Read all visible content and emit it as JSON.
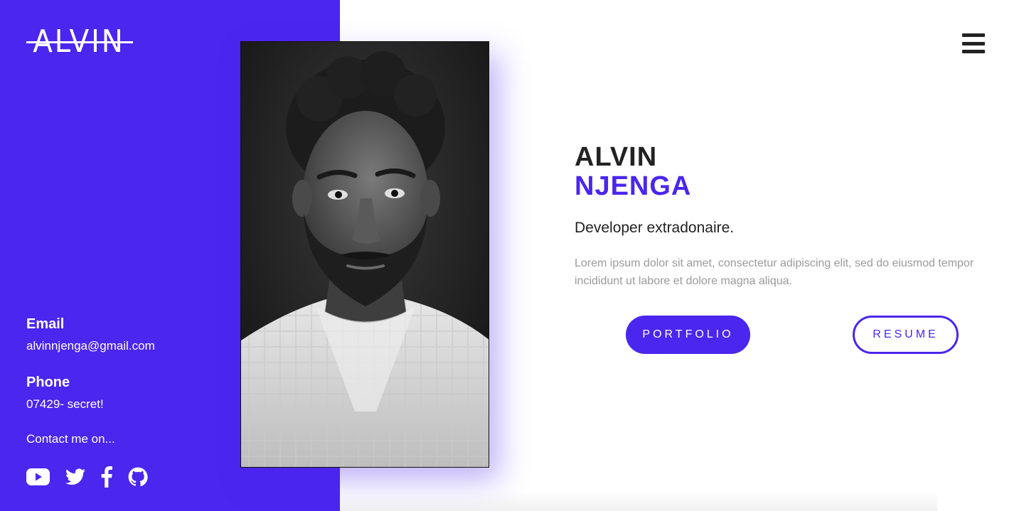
{
  "brand": {
    "logo_text": "ALVIN"
  },
  "header": {
    "menu_icon": "hamburger-menu-icon"
  },
  "hero": {
    "first_name": "ALVIN",
    "last_name": "NJENGA",
    "tagline": "Developer extradonaire.",
    "bio": "Lorem ipsum dolor sit amet, consectetur adipiscing elit, sed do eiusmod tempor incididunt ut labore et dolore magna aliqua.",
    "portfolio_label": "PORTFOLIO",
    "resume_label": "RESUME"
  },
  "contact": {
    "email_heading": "Email",
    "email_value": "alvinnjenga@gmail.com",
    "phone_heading": "Phone",
    "phone_value": "07429- secret!",
    "cta": "Contact me on..."
  },
  "social": [
    {
      "name": "youtube",
      "icon": "youtube-icon"
    },
    {
      "name": "twitter",
      "icon": "twitter-icon"
    },
    {
      "name": "facebook",
      "icon": "facebook-icon"
    },
    {
      "name": "github",
      "icon": "github-icon"
    }
  ],
  "colors": {
    "accent": "#4a26ee",
    "text_dark": "#222222",
    "text_muted": "#9a9a9a",
    "background": "#ffffff"
  }
}
